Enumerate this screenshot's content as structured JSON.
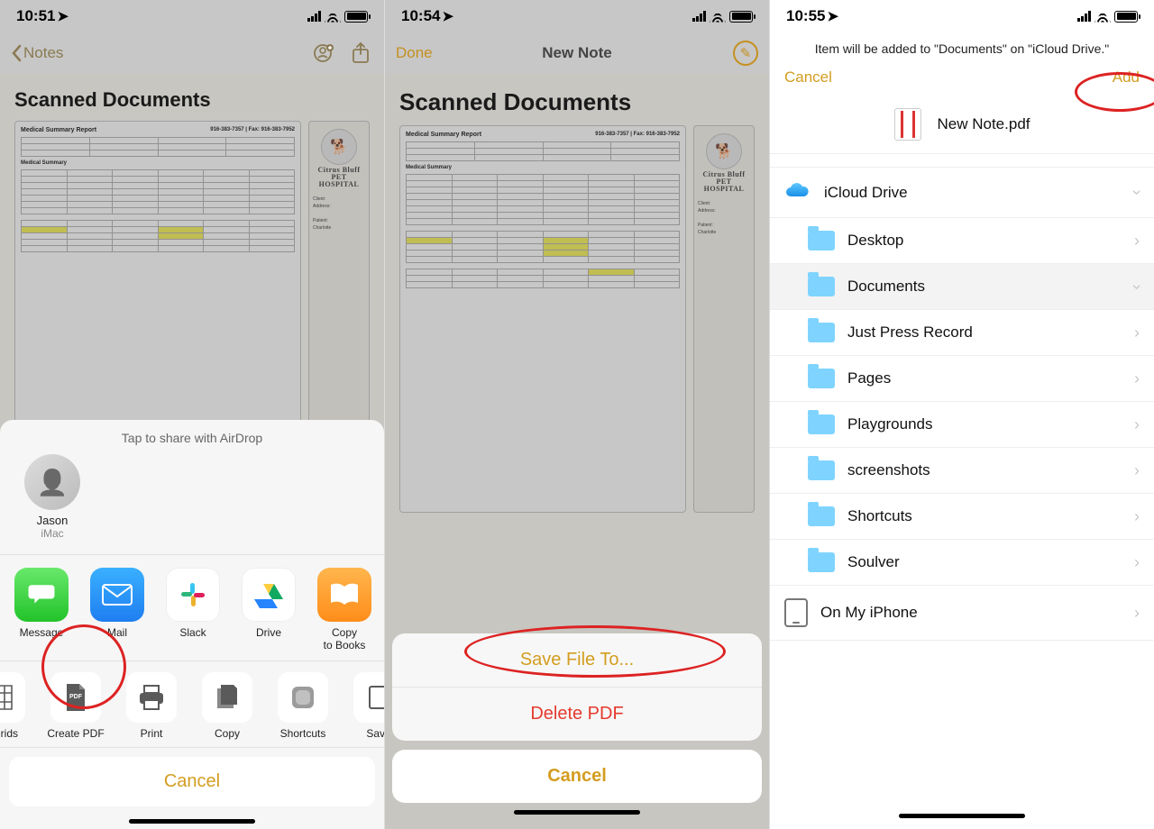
{
  "panel1": {
    "time": "10:51",
    "nav_back": "Notes",
    "title": "Scanned Documents",
    "doc_title": "Medical Summary Report",
    "doc_fax": "916-383-7357 | Fax: 916-383-7952",
    "doc_section": "Medical Summary",
    "side_brand1": "Citrus Bluff",
    "side_brand2": "PET HOSPITAL",
    "airdrop_header": "Tap to share with AirDrop",
    "contact_name": "Jason",
    "contact_sub": "iMac",
    "apps": {
      "message": "Message",
      "mail": "Mail",
      "slack": "Slack",
      "drive": "Drive",
      "books": "Copy\nto Books"
    },
    "actions": {
      "grids": "& Grids",
      "createpdf": "Create PDF",
      "print": "Print",
      "copy": "Copy",
      "shortcuts": "Shortcuts",
      "save": "Save"
    },
    "cancel": "Cancel"
  },
  "panel2": {
    "time": "10:54",
    "done": "Done",
    "title": "New Note",
    "heading": "Scanned Documents",
    "save": "Save File To...",
    "delete": "Delete PDF",
    "cancel": "Cancel"
  },
  "panel3": {
    "time": "10:55",
    "message": "Item will be added to \"Documents\" on \"iCloud Drive.\"",
    "cancel": "Cancel",
    "add": "Add",
    "filename": "New Note.pdf",
    "locations": {
      "icloud": "iCloud Drive",
      "onmyiphone": "On My iPhone"
    },
    "folders": {
      "desktop": "Desktop",
      "documents": "Documents",
      "jpr": "Just Press Record",
      "pages": "Pages",
      "playgrounds": "Playgrounds",
      "screenshots": "screenshots",
      "shortcuts": "Shortcuts",
      "soulver": "Soulver"
    }
  }
}
